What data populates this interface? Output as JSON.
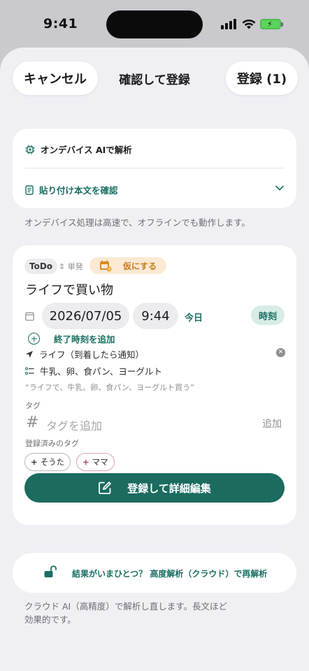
{
  "status_bar": {
    "time": "9:41"
  },
  "header": {
    "cancel_label": "キャンセル",
    "title": "確認して登録",
    "register_label": "登録 (1)"
  },
  "analysis_card": {
    "on_device_label": "オンデバイス AIで解析",
    "paste_label": "貼り付け本文を確認",
    "note": "オンデバイス処理は高速で、オフラインでも動作します。"
  },
  "item": {
    "type_chip": "ToDo",
    "type_selector": "単発",
    "tentative_label": "仮にする",
    "title": "ライフで買い物",
    "date": "2026/07/05",
    "time": "9:44",
    "today_label": "今日",
    "time_toggle": "時刻",
    "add_end_time": "終了時刻を追加",
    "location": "ライフ（到着したら通知）",
    "checklist": "牛乳、卵、食パン、ヨーグルト",
    "source_quote": "“ライフで、牛乳、卵、食パン、ヨーグルト買う”",
    "tag_section_label": "タグ",
    "tag_placeholder": "タグを追加",
    "tag_add_label": "追加",
    "registered_tags_label": "登録済みのタグ",
    "registered_tags": [
      "そうた",
      "ママ"
    ],
    "save_detail_label": "登録して詳細編集"
  },
  "cloud": {
    "reanalyze_label": "結果がいまひとつ？ 高度解析（クラウド）で再解析",
    "note_line1": "クラウド AI（高精度）で解析し直します。長文ほど",
    "note_line2": "効果的です。"
  },
  "colors": {
    "accent": "#1b6b5f",
    "tentative": "#c77b1a",
    "background": "#efeff4"
  }
}
